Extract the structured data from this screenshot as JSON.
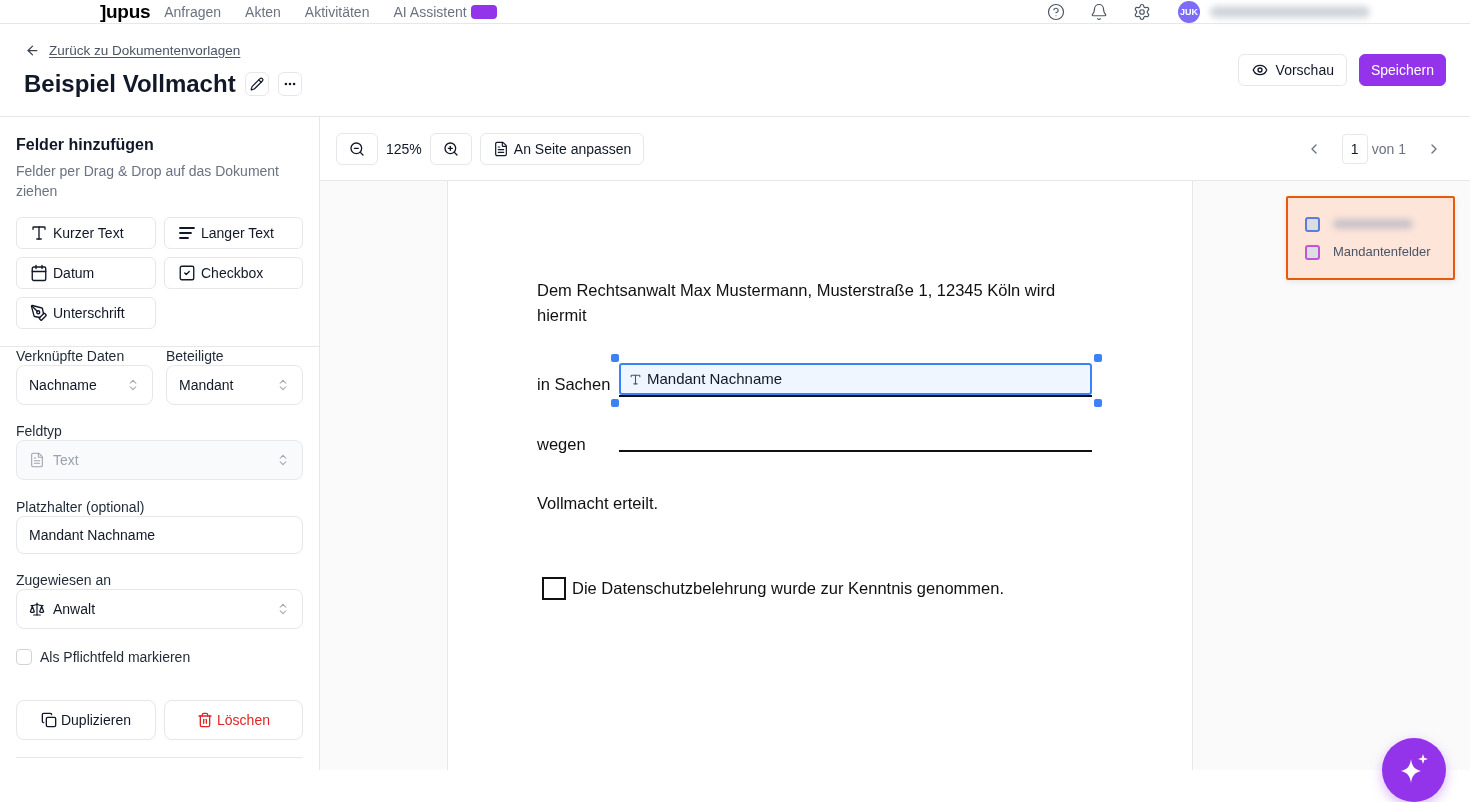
{
  "top_nav": {
    "logo": "]upus",
    "items": [
      {
        "label": "Anfragen",
        "badge": false
      },
      {
        "label": "Akten",
        "badge": false
      },
      {
        "label": "Aktivitäten",
        "badge": false
      },
      {
        "label": "AI Assistent",
        "badge": true
      }
    ],
    "user": {
      "avatar": "JUK",
      "name_blurred": true
    }
  },
  "header": {
    "back_link": "Zurück zu Dokumentenvorlagen",
    "title": "Beispiel Vollmacht",
    "buttons": [
      {
        "label": "Vorschau",
        "kind": "secondary"
      },
      {
        "label": "Speichern",
        "kind": "primary"
      }
    ]
  },
  "sidebar": {
    "title": "Felder hinzufügen",
    "description": "Felder per Drag & Drop auf das Dokument ziehen",
    "field_types": [
      {
        "label": "Kurzer Text",
        "kind": "short-text"
      },
      {
        "label": "Langer Text",
        "kind": "long-text"
      },
      {
        "label": "Datum",
        "kind": "date"
      },
      {
        "label": "Checkbox",
        "kind": "checkbox"
      },
      {
        "label": "Unterschrift",
        "kind": "signature"
      }
    ],
    "properties": {
      "linked_data": {
        "label": "Verknüpfte Daten",
        "value": "Nachname"
      },
      "participant": {
        "label": "Beteiligte",
        "value": "Mandant"
      },
      "field_type": {
        "label": "Feldtyp",
        "value": "Text",
        "disabled": true
      },
      "placeholder": {
        "label": "Platzhalter (optional)",
        "value": "Mandant Nachname"
      },
      "assigned_to": {
        "label": "Zugewiesen an",
        "value": "Anwalt"
      },
      "required": {
        "label": "Als Pflichtfeld markieren",
        "checked": false
      }
    },
    "actions": [
      {
        "label": "Duplizieren",
        "kind": "duplicate"
      },
      {
        "label": "Löschen",
        "kind": "delete"
      }
    ]
  },
  "toolbar": {
    "zoom": "125%",
    "fit_button": "An Seite anpassen",
    "page": "1",
    "page_total": "von 1"
  },
  "document": {
    "blocks": [
      {
        "kind": "paragraph",
        "text": "Dem Rechtsanwalt Max Mustermann, Musterstraße 1, 12345 Köln wird hiermit"
      },
      {
        "kind": "field_line",
        "label": "in Sachen",
        "field": {
          "label": "Mandant Nachname",
          "selected": true
        }
      },
      {
        "kind": "field_line",
        "label": "wegen"
      },
      {
        "kind": "paragraph",
        "text": "Vollmacht erteilt."
      },
      {
        "kind": "checkbox",
        "label": "Die Datenschutzbelehrung wurde zur Kenntnis genommen.",
        "checked": false
      }
    ]
  },
  "legend": {
    "items": [
      {
        "kind": "blurred",
        "color": "#5b7fd6"
      },
      {
        "kind": "text",
        "label": "Mandantenfelder",
        "color": "#c055d6"
      }
    ]
  }
}
